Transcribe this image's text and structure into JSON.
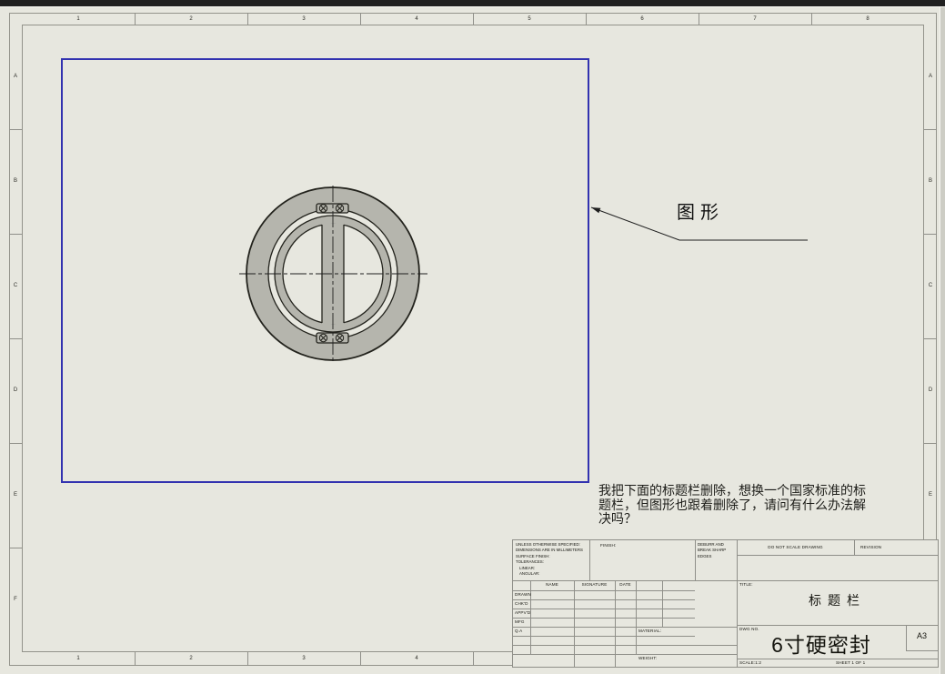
{
  "colors": {
    "paper": "#e7e7df",
    "part_gray": "#b5b5ad",
    "view_border_blue": "#3232b0",
    "line_dark": "#22221c",
    "frame_gray": "#93938b"
  },
  "sheet": {
    "zone_columns": [
      "1",
      "2",
      "3",
      "4",
      "5",
      "6",
      "7",
      "8"
    ],
    "zone_rows": [
      "A",
      "B",
      "C",
      "D",
      "E",
      "F"
    ]
  },
  "view_annotation": {
    "label": "图形"
  },
  "note": {
    "line1": "我把下面的标题栏删除，想换一个国家标准的标",
    "line2": "题栏，但图形也跟着删除了，请问有什么办法解",
    "line3": "决吗？"
  },
  "title_block": {
    "tolerance_block": {
      "l1": "UNLESS OTHERWISE SPECIFIED:",
      "l2": "DIMENSIONS ARE IN MILLIMETERS",
      "l3": "SURFACE FINISH:",
      "l4": "TOLERANCES:",
      "l5": "LINEAR:",
      "l6": "ANGULAR:"
    },
    "finish_label": "FINISH:",
    "deburr_note": {
      "l1": "DEBURR AND",
      "l2": "BREAK SHARP",
      "l3": "EDGES"
    },
    "do_not_scale": "DO NOT SCALE DRAWING",
    "revision_label": "REVISION",
    "table": {
      "headers": [
        "NAME",
        "SIGNATURE",
        "DATE"
      ],
      "rows": [
        "DRAWN",
        "CHK'D",
        "APPV'D",
        "MFG",
        "Q.A"
      ]
    },
    "material_label": "MATERIAL:",
    "weight_label": "WEIGHT:",
    "title_label": "TITLE:",
    "title_value": "标题栏",
    "dwg_label": "DWG NO.",
    "dwg_value": "6寸硬密封",
    "size_value": "A3",
    "scale_label": "SCALE:1:2",
    "sheet_label": "SHEET 1 OF 1"
  }
}
